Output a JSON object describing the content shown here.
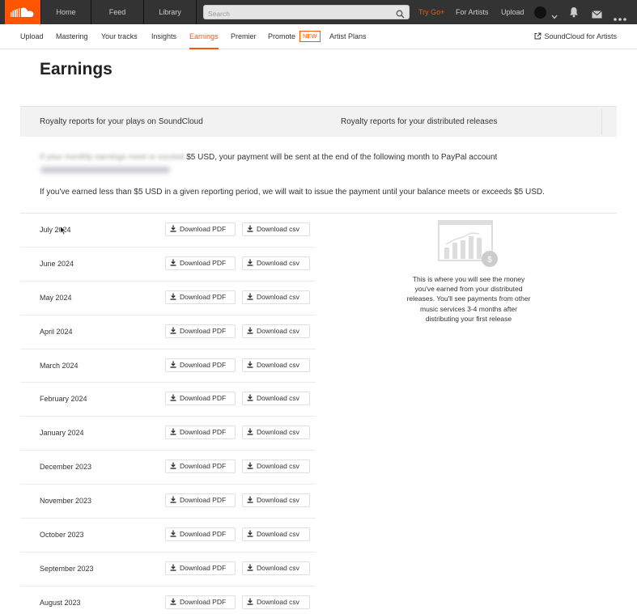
{
  "colors": {
    "brand": "#ff5500",
    "header_bg": "#333333"
  },
  "header": {
    "logo_icon": "soundcloud-logo-icon",
    "nav": [
      "Home",
      "Feed",
      "Library"
    ],
    "search_placeholder": "Search",
    "try_go": "Try Go+",
    "for_artists": "For Artists",
    "upload": "Upload",
    "icons": [
      "search-icon",
      "avatar",
      "chevron-down-icon",
      "bell-icon",
      "mail-icon",
      "more-icon"
    ]
  },
  "subnav": {
    "items": [
      "Upload",
      "Mastering",
      "Your tracks",
      "Insights",
      "Earnings",
      "Premier",
      "Promote",
      "Artist Plans"
    ],
    "active": "Earnings",
    "new_badge": "NEW",
    "soundcloud_for_artists": "SoundCloud for Artists"
  },
  "page": {
    "title": "Earnings",
    "tabs": [
      "Royalty reports for your plays on SoundCloud",
      "Royalty reports for your distributed releases"
    ],
    "info_blurred_prefix": "If your monthly earnings meet or exceed",
    "info_line1": " $5 USD, your payment will be sent at the end of the following month to PayPal account",
    "info_line2": "If you've earned less than $5 USD in a given reporting period, we will wait to issue the payment until your balance meets or exceeds $5 USD.",
    "download_pdf": "Download PDF",
    "download_csv": "Download csv",
    "months": [
      "July 2024",
      "June 2024",
      "May 2024",
      "April 2024",
      "March 2024",
      "February 2024",
      "January 2024",
      "December 2023",
      "November 2023",
      "October 2023",
      "September 2023",
      "August 2023"
    ],
    "empty_state": "This is where you will see the money you've earned from your distributed releases. You'll see payments from other music services 3-4 months after distributing your first release"
  }
}
